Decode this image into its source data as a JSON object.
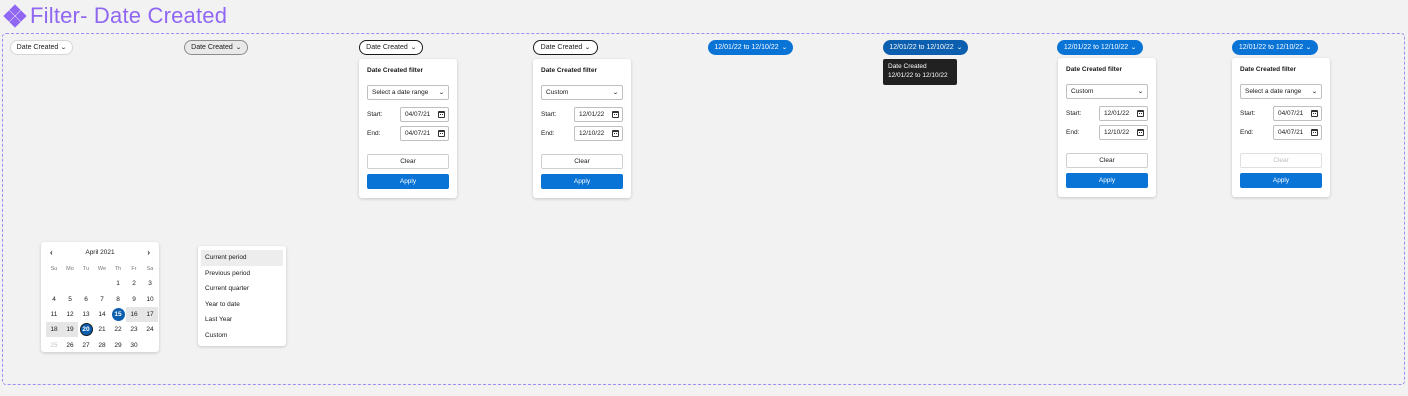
{
  "header": {
    "title": "Filter- Date Created",
    "icon": "component-icon"
  },
  "pills": [
    {
      "label": "Date Created",
      "state": "default"
    },
    {
      "label": "Date Created",
      "state": "hover"
    },
    {
      "label": "Date Created",
      "state": "active"
    },
    {
      "label": "Date Created",
      "state": "active"
    },
    {
      "label": "12/01/22 to 12/10/22",
      "state": "selected"
    },
    {
      "label": "12/01/22 to 12/10/22",
      "state": "selected-hover"
    },
    {
      "label": "12/01/22 to 12/10/22",
      "state": "selected"
    },
    {
      "label": "12/01/22 to 12/10/22",
      "state": "selected"
    }
  ],
  "tooltip": {
    "line1": "Date Created",
    "line2": "12/01/22 to 12/10/22"
  },
  "cards": [
    {
      "title": "Date Created filter",
      "select": "Select a date range",
      "start_label": "Start:",
      "start": "04/07/21",
      "end_label": "End:",
      "end": "04/07/21",
      "clear": "Clear",
      "apply": "Apply",
      "clear_disabled": false
    },
    {
      "title": "Date Created filter",
      "select": "Custom",
      "start_label": "Start:",
      "start": "12/01/22",
      "end_label": "End:",
      "end": "12/10/22",
      "clear": "Clear",
      "apply": "Apply",
      "clear_disabled": false
    },
    {
      "title": "Date Created filter",
      "select": "Custom",
      "start_label": "Start:",
      "start": "12/01/22",
      "end_label": "End:",
      "end": "12/10/22",
      "clear": "Clear",
      "apply": "Apply",
      "clear_disabled": false
    },
    {
      "title": "Date Created filter",
      "select": "Select a date range",
      "start_label": "Start:",
      "start": "04/07/21",
      "end_label": "End:",
      "end": "04/07/21",
      "clear": "Clear",
      "apply": "Apply",
      "clear_disabled": true
    }
  ],
  "calendar": {
    "month": "April 2021",
    "prev": "‹",
    "next": "›",
    "weekdays": [
      "Su",
      "Mo",
      "Tu",
      "We",
      "Th",
      "Fr",
      "Sa"
    ],
    "weeks": [
      [
        "",
        "",
        "",
        "",
        "1",
        "2",
        "3"
      ],
      [
        "4",
        "5",
        "6",
        "7",
        "8",
        "9",
        "10"
      ],
      [
        "11",
        "12",
        "13",
        "14",
        "15",
        "16",
        "17"
      ],
      [
        "18",
        "19",
        "20",
        "21",
        "22",
        "23",
        "24"
      ],
      [
        "25",
        "26",
        "27",
        "28",
        "29",
        "30",
        ""
      ]
    ],
    "selected_start": "15",
    "selected_end": "20",
    "range_days": [
      "16",
      "17",
      "18",
      "19"
    ],
    "muted_days": [
      "25"
    ]
  },
  "presets": [
    "Current period",
    "Previous period",
    "Current quarter",
    "Year to date",
    "Last Year",
    "Custom"
  ],
  "colors": {
    "accent": "#8f67f1",
    "primary": "#0a74d6",
    "primary_dark": "#0c5fae",
    "tooltip": "#212121"
  }
}
